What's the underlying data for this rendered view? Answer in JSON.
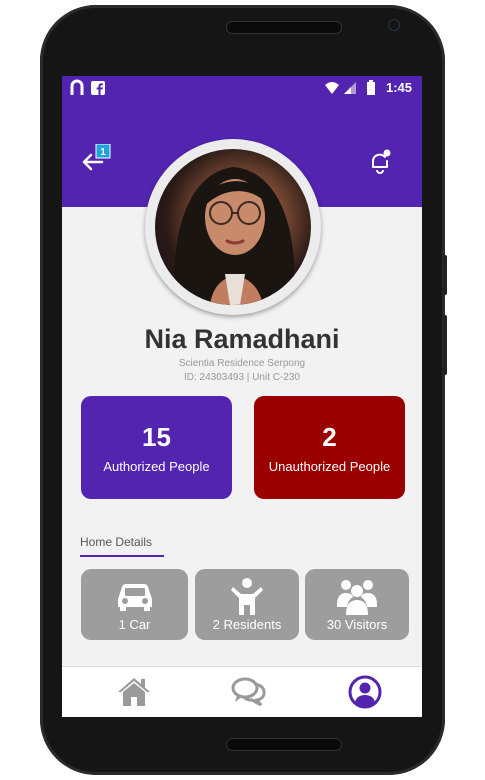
{
  "status": {
    "time": "1:45"
  },
  "header": {
    "back_badge": "1"
  },
  "profile": {
    "name": "Nia Ramadhani",
    "residence": "Scientia Residence Serpong",
    "id_unit": "ID: 24303493 | Unit C-230"
  },
  "stats": [
    {
      "value": "15",
      "label": "Authorized People",
      "color": "#5224b0"
    },
    {
      "value": "2",
      "label": "Unauthorized People",
      "color": "#9b0000"
    }
  ],
  "home_details": {
    "title": "Home Details",
    "items": [
      {
        "label": "1 Car",
        "icon": "car-icon"
      },
      {
        "label": "2 Residents",
        "icon": "person-icon"
      },
      {
        "label": "30 Visitors",
        "icon": "group-icon"
      }
    ]
  },
  "nav": {
    "items": [
      "home-icon",
      "chat-icon",
      "profile-icon"
    ],
    "active": "profile-icon",
    "active_color": "#5224b0",
    "inactive_color": "#9a9a9a"
  }
}
